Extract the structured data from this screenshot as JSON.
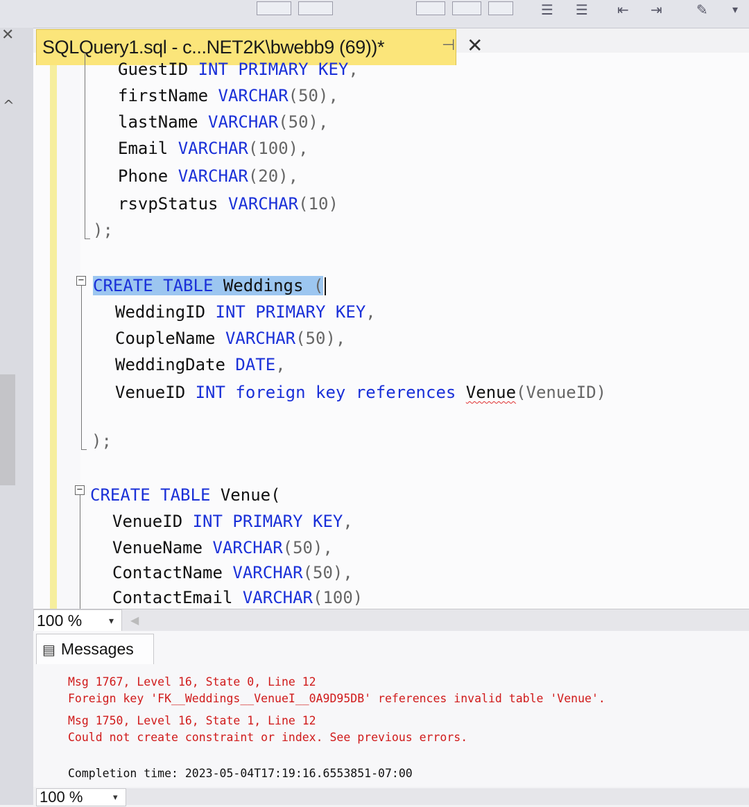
{
  "toolbar": {
    "icons": [
      "grid-icon",
      "grid-icon",
      "grid-icon",
      "align-left-icon",
      "align-right-icon",
      "indent-icon",
      "outdent-icon",
      "comment-icon",
      "overflow-chevron-icon"
    ]
  },
  "document_tab": {
    "title": "SQLQuery1.sql - c...NET2K\\bwebb9 (69))*",
    "pin_glyph": "⊣",
    "close_glyph": "✕"
  },
  "editor": {
    "lines": [
      {
        "indent": "GuestID",
        "rest": [
          " ",
          "INT",
          " ",
          "PRIMARY",
          " ",
          "KEY",
          ","
        ]
      },
      {
        "indent": "firstName",
        "rest": [
          " ",
          "VARCHAR",
          "(50),"
        ]
      },
      {
        "indent": "lastName",
        "rest": [
          " ",
          "VARCHAR",
          "(50),"
        ]
      },
      {
        "indent": "Email",
        "rest": [
          " ",
          "VARCHAR",
          "(100),"
        ]
      },
      {
        "indent": "Phone",
        "rest": [
          " ",
          "VARCHAR",
          "(20),"
        ]
      },
      {
        "indent": "rsvpStatus",
        "rest": [
          " ",
          "VARCHAR",
          "(10)"
        ]
      }
    ],
    "close1": ");",
    "weddings": {
      "create": "CREATE",
      "table": "TABLE",
      "name": "Weddings",
      "paren": "(",
      "cols": [
        {
          "name": "WeddingID",
          "t1": "INT",
          "t2": "PRIMARY",
          "t3": "KEY",
          "tail": ","
        },
        {
          "name": "CoupleName",
          "t1": "VARCHAR",
          "tail": "(50),"
        },
        {
          "name": "WeddingDate",
          "t1": "DATE",
          "tail": ","
        }
      ],
      "fk": {
        "name": "VenueID",
        "int": "INT",
        "foreign": "foreign",
        "key": "key",
        "references": "references",
        "target": "Venue",
        "target_col": "(VenueID)"
      },
      "close": ");"
    },
    "venue": {
      "create": "CREATE",
      "table": "TABLE",
      "name": "Venue(",
      "cols": [
        {
          "name": "VenueID",
          "t1": "INT",
          "t2": "PRIMARY",
          "t3": "KEY",
          "tail": ","
        },
        {
          "name": "VenueName",
          "t1": "VARCHAR",
          "tail": "(50),"
        },
        {
          "name": "ContactName",
          "t1": "VARCHAR",
          "tail": "(50),"
        },
        {
          "name": "ContactEmail",
          "t1": "VARCHAR",
          "tail": "(100)"
        }
      ]
    }
  },
  "zoom": {
    "value": "100 %",
    "arrow": "▾"
  },
  "messages_tab": {
    "label": "Messages",
    "icon": "messages-icon"
  },
  "messages": [
    {
      "text": "Msg 1767, Level 16, State 0, Line 12",
      "kind": "error"
    },
    {
      "text": "Foreign key 'FK__Weddings__VenueI__0A9D95DB' references invalid table 'Venue'.",
      "kind": "error"
    },
    {
      "text": "Msg 1750, Level 16, State 1, Line 12",
      "kind": "error"
    },
    {
      "text": "Could not create constraint or index. See previous errors.",
      "kind": "error"
    },
    {
      "text": "Completion time: 2023-05-04T17:19:16.6553851-07:00",
      "kind": "info"
    }
  ],
  "bottom_zoom": {
    "value": "100 %",
    "arrow": "▾"
  },
  "colors": {
    "keyword": "#1a30d8",
    "error_text": "#d01a1a",
    "tab_active": "#fbe57a",
    "selection": "#9cc6f0"
  }
}
